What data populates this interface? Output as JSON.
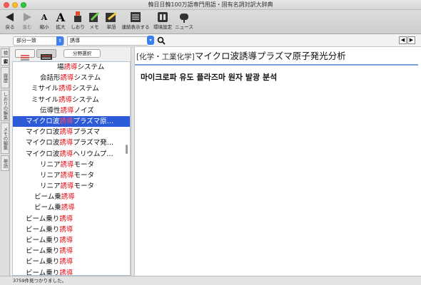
{
  "window": {
    "title": "韓日日韓100万語専門用語・固有名詞対訳大辞典"
  },
  "toolbar": {
    "back": "戻る",
    "forward": "進む",
    "shrink": "縮小",
    "enlarge": "拡大",
    "bookmark": "しおり",
    "memo": "メモ",
    "wordbook": "単語",
    "continuous": "連続表示する",
    "settings": "環境設定",
    "news": "ニュース"
  },
  "search": {
    "match_mode": "部分一致",
    "query": "誘導",
    "category": ""
  },
  "left_tabs": [
    "検",
    "索",
    "履歴",
    "しおりの編集",
    "メモの編集",
    "単語"
  ],
  "list_tools": {
    "split_select": "分野選択"
  },
  "results": [
    {
      "pre": "場",
      "hit": "誘導",
      "post": "システム",
      "indent": 62
    },
    {
      "pre": "会話形",
      "hit": "誘導",
      "post": "システム",
      "indent": 38
    },
    {
      "pre": "ミサイル",
      "hit": "誘導",
      "post": "システム",
      "indent": 26
    },
    {
      "pre": "ミサイル",
      "hit": "誘導",
      "post": "システム",
      "indent": 26
    },
    {
      "pre": "伝導性",
      "hit": "誘導",
      "post": "ノイズ",
      "indent": 38
    },
    {
      "pre": "マイクロ波",
      "hit": "誘導",
      "post": "プラズマ原…",
      "indent": 18,
      "selected": true
    },
    {
      "pre": "マイクロ波",
      "hit": "誘導",
      "post": "プラズマ",
      "indent": 18
    },
    {
      "pre": "マイクロ波",
      "hit": "誘導",
      "post": "プラズマ発…",
      "indent": 18
    },
    {
      "pre": "マイクロ波",
      "hit": "誘導",
      "post": "ヘリウムプ…",
      "indent": 18
    },
    {
      "pre": "リニア",
      "hit": "誘導",
      "post": "モータ",
      "indent": 38
    },
    {
      "pre": "リニア",
      "hit": "誘導",
      "post": "モータ",
      "indent": 38
    },
    {
      "pre": "リニア",
      "hit": "誘導",
      "post": "モータ",
      "indent": 38
    },
    {
      "pre": "ビーム乗",
      "hit": "誘導",
      "post": "",
      "indent": 30
    },
    {
      "pre": "ビーム乗",
      "hit": "誘導",
      "post": "",
      "indent": 30
    },
    {
      "pre": "ビーム乗り",
      "hit": "誘導",
      "post": "",
      "indent": 18
    },
    {
      "pre": "ビーム乗り",
      "hit": "誘導",
      "post": "",
      "indent": 18
    },
    {
      "pre": "ビーム乗り",
      "hit": "誘導",
      "post": "",
      "indent": 18
    },
    {
      "pre": "ビーム乗り",
      "hit": "誘導",
      "post": "",
      "indent": 18
    },
    {
      "pre": "ビーム乗り",
      "hit": "誘導",
      "post": "",
      "indent": 18
    },
    {
      "pre": "ビーム乗り",
      "hit": "誘導",
      "post": "",
      "indent": 18
    }
  ],
  "entry": {
    "field": "[化学・工業化学]",
    "headword": "マイクロ波誘導プラズマ原子発光分析",
    "translation": "마이크로파 유도 플라즈마 원자 발광 분석"
  },
  "status": {
    "text": "3759件見つかりました。"
  },
  "colors": {
    "highlight": "#e0111a",
    "selection": "#2d5bd7",
    "accent": "#3b7ff0"
  }
}
